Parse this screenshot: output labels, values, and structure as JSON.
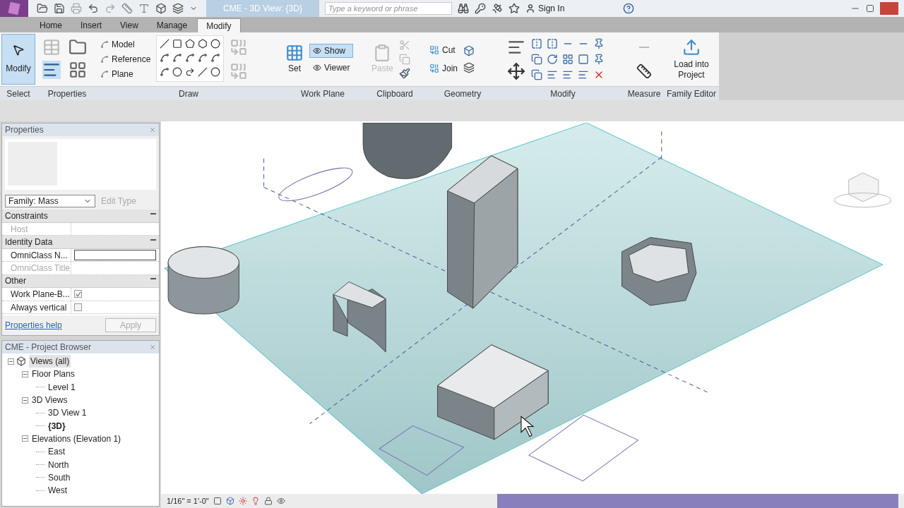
{
  "title_bar": {
    "title": "CME - 3D View: {3D}",
    "search_placeholder": "Type a keyword or phrase",
    "sign_in": "Sign In"
  },
  "tabs": [
    {
      "label": "Home",
      "selected": false
    },
    {
      "label": "Insert",
      "selected": false
    },
    {
      "label": "View",
      "selected": false
    },
    {
      "label": "Manage",
      "selected": false
    },
    {
      "label": "Modify",
      "selected": true
    }
  ],
  "ribbon": {
    "select": {
      "label": "Select",
      "button": "Modify",
      "selected": true
    },
    "properties": {
      "label": "Properties"
    },
    "draw": {
      "label": "Draw",
      "items": [
        "Model",
        "Reference",
        "Plane"
      ]
    },
    "work_plane": {
      "label": "Work Plane",
      "set": "Set",
      "items": [
        {
          "label": "Show",
          "selected": true
        },
        {
          "label": "Viewer",
          "selected": false
        }
      ]
    },
    "clipboard": {
      "label": "Clipboard",
      "paste": "Paste",
      "paste_disabled": true
    },
    "geometry": {
      "label": "Geometry",
      "items": [
        "Cut",
        "Join"
      ]
    },
    "modify": {
      "label": "Modify"
    },
    "measure": {
      "label": "Measure"
    },
    "family_editor": {
      "label": "Family Editor",
      "button": "Load into Project"
    }
  },
  "properties": {
    "title": "Properties",
    "family": "Family: Mass",
    "edit_type": "Edit Type",
    "edit_type_disabled": true,
    "groups": [
      {
        "name": "Constraints",
        "rows": [
          {
            "kind": "text",
            "label": "Host",
            "disabled": true
          }
        ]
      },
      {
        "name": "Identity Data",
        "rows": [
          {
            "kind": "field",
            "label": "OmniClass N...",
            "disabled": false
          },
          {
            "kind": "text",
            "label": "OmniClass Title",
            "disabled": true
          }
        ]
      },
      {
        "name": "Other",
        "rows": [
          {
            "kind": "check",
            "label": "Work Plane-B...",
            "disabled": false,
            "checked": true
          },
          {
            "kind": "check",
            "label": "Always vertical",
            "disabled": false,
            "checked": false
          }
        ]
      }
    ],
    "help": "Properties help",
    "apply": "Apply"
  },
  "project_browser": {
    "title": "CME - Project Browser",
    "tree": [
      {
        "label": "Views (all)",
        "selected": true,
        "bold": false,
        "expanded": true,
        "children": [
          {
            "label": "Floor Plans",
            "selected": false,
            "bold": false,
            "expanded": true,
            "children": [
              {
                "label": "Level 1",
                "selected": false,
                "bold": false
              }
            ]
          },
          {
            "label": "3D Views",
            "selected": false,
            "bold": false,
            "expanded": true,
            "children": [
              {
                "label": "3D View 1",
                "selected": false,
                "bold": false
              },
              {
                "label": "{3D}",
                "selected": false,
                "bold": true
              }
            ]
          },
          {
            "label": "Elevations (Elevation 1)",
            "selected": false,
            "bold": false,
            "expanded": true,
            "children": [
              {
                "label": "East",
                "selected": false,
                "bold": false
              },
              {
                "label": "North",
                "selected": false,
                "bold": false
              },
              {
                "label": "South",
                "selected": false,
                "bold": false
              },
              {
                "label": "West",
                "selected": false,
                "bold": false
              }
            ]
          }
        ]
      }
    ]
  },
  "view_bar": {
    "scale": "1/16\" = 1'-0\""
  }
}
